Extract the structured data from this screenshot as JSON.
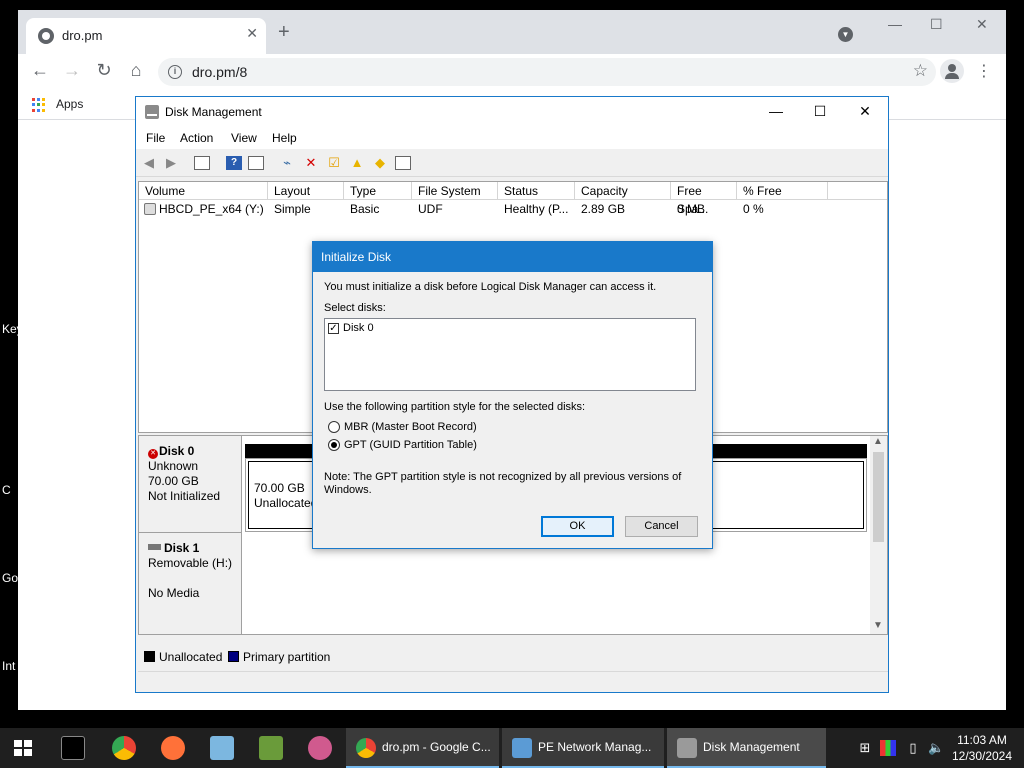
{
  "desktop": {
    "edge_labels": [
      "Key",
      "C",
      "Go",
      "Int"
    ]
  },
  "browser": {
    "tab_title": "dro.pm",
    "url": "dro.pm/8",
    "bookmarks": {
      "apps_label": "Apps"
    }
  },
  "disk_management": {
    "title": "Disk Management",
    "menu": [
      "File",
      "Action",
      "View",
      "Help"
    ],
    "columns": [
      "Volume",
      "Layout",
      "Type",
      "File System",
      "Status",
      "Capacity",
      "Free Spa...",
      "% Free"
    ],
    "volumes": [
      {
        "volume": "HBCD_PE_x64 (Y:)",
        "layout": "Simple",
        "type": "Basic",
        "file_system": "UDF",
        "status": "Healthy (P...",
        "capacity": "2.89 GB",
        "free_space": "0 MB",
        "percent_free": "0 %"
      }
    ],
    "disks": [
      {
        "name": "Disk 0",
        "type": "Unknown",
        "size": "70.00 GB",
        "state": "Not Initialized",
        "partition_size": "70.00 GB",
        "partition_label": "Unallocated"
      },
      {
        "name": "Disk 1",
        "type": "Removable (H:)",
        "state": "No Media"
      }
    ],
    "legend": [
      {
        "label": "Unallocated",
        "color": "#000000"
      },
      {
        "label": "Primary partition",
        "color": "#00007f"
      }
    ]
  },
  "initialize_dialog": {
    "title": "Initialize Disk",
    "message": "You must initialize a disk before Logical Disk Manager can access it.",
    "select_label": "Select disks:",
    "disk_item": "Disk 0",
    "partition_label": "Use the following partition style for the selected disks:",
    "options": [
      {
        "label": "MBR (Master Boot Record)",
        "selected": false
      },
      {
        "label": "GPT (GUID Partition Table)",
        "selected": true
      }
    ],
    "note_line1": "Note: The GPT partition style is not recognized by all previous versions of",
    "note_line2": "Windows.",
    "ok_label": "OK",
    "cancel_label": "Cancel"
  },
  "taskbar": {
    "tasks": [
      {
        "label": "dro.pm - Google C...",
        "icon": "chrome-icon"
      },
      {
        "label": "PE Network Manag...",
        "icon": "network-manager-icon"
      },
      {
        "label": "Disk Management",
        "icon": "disk-management-icon"
      }
    ],
    "time": "11:03 AM",
    "date": "12/30/2024"
  },
  "colors": {
    "accent": "#1979ca",
    "taskbar": "#1f1f1f",
    "unallocated": "#000000",
    "primary_partition": "#00007f"
  }
}
